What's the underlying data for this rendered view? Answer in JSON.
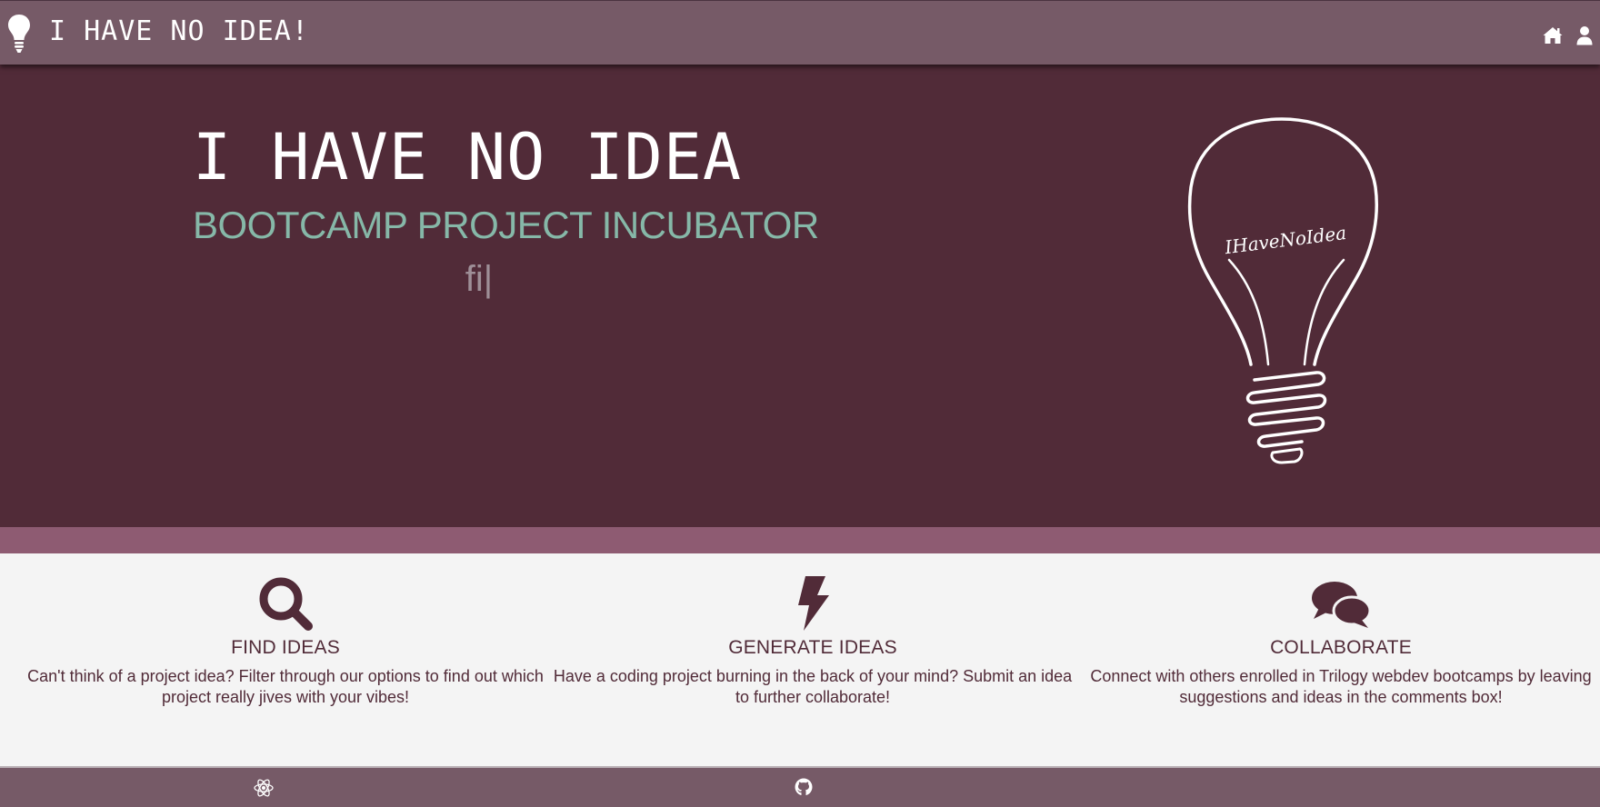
{
  "navbar": {
    "logo_icon": "lightbulb-icon",
    "title": "I HAVE NO IDEA!",
    "home_icon": "home-icon",
    "user_icon": "user-icon"
  },
  "hero": {
    "title": "I HAVE NO IDEA",
    "subtitle": "BOOTCAMP PROJECT INCUBATOR",
    "typing_text": "fi|",
    "illustration_icon": "lightbulb-illustration",
    "illustration_script": "IHaveNoIdea"
  },
  "features": [
    {
      "icon": "search-icon",
      "title": "FIND IDEAS",
      "description": "Can't think of a project idea? Filter through our options to find out which project really jives with your vibes!"
    },
    {
      "icon": "bolt-icon",
      "title": "GENERATE IDEAS",
      "description": "Have a coding project burning in the back of your mind? Submit an idea to further collaborate!"
    },
    {
      "icon": "comments-icon",
      "title": "COLLABORATE",
      "description": "Connect with others enrolled in Trilogy webdev bootcamps by leaving suggestions and ideas in the comments box!"
    }
  ],
  "footer": {
    "left_icon": "react-icon",
    "center_icon": "github-icon"
  },
  "colors": {
    "navbar_bg": "#765a67",
    "hero_bg": "#512b38",
    "accent_band": "#8e5b72",
    "subtitle": "#86b8a8",
    "features_bg": "#f4f4f4",
    "feature_text": "#512b38"
  }
}
